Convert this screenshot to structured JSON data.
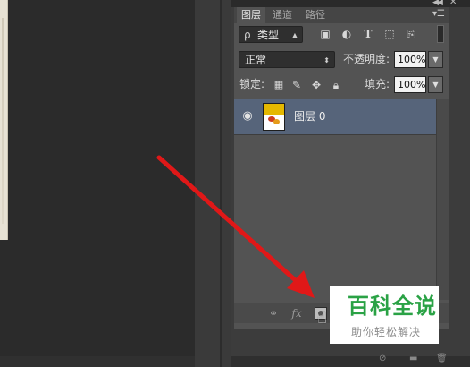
{
  "panel": {
    "tabs": [
      "图层",
      "通道",
      "路径"
    ],
    "filter": {
      "search_glyph": "ρ",
      "kind_label": "类型"
    },
    "blend": {
      "mode": "正常",
      "opacity_label": "不透明度:",
      "opacity_value": "100%"
    },
    "lock": {
      "label": "锁定:",
      "fill_label": "填充:",
      "fill_value": "100%"
    },
    "layers": [
      {
        "name": "图层 0",
        "visible": true,
        "selected": true
      }
    ],
    "footer": {
      "fx_label": "fx"
    }
  },
  "watermark": {
    "title": "百科全说",
    "subtitle": "助你轻松解决"
  },
  "colors": {
    "arrow": "#e01818",
    "selection": "#56647a",
    "watermark_green": "#2aa245"
  },
  "icons": [
    "eye-icon",
    "link-icon",
    "fx-icon",
    "add-mask-icon",
    "lock-pixels-icon",
    "lock-position-icon",
    "lock-all-icon",
    "filter-image-icon",
    "filter-adjustment-icon",
    "filter-type-icon",
    "filter-shape-icon",
    "filter-smart-object-icon"
  ]
}
